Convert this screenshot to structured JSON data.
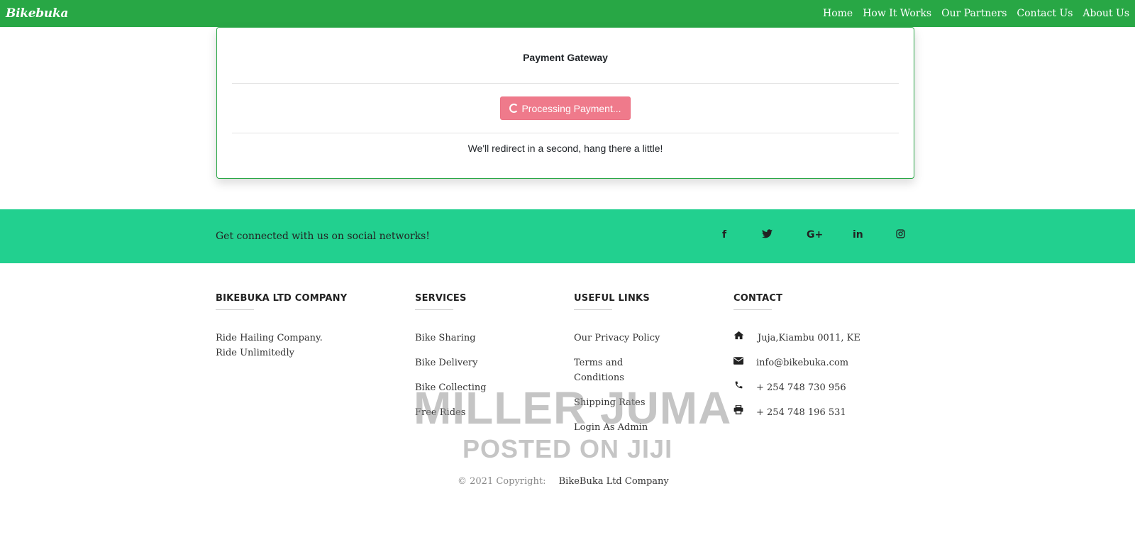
{
  "navbar": {
    "brand": "Bikebuka",
    "links": [
      "Home",
      "How It Works",
      "Our Partners",
      "Contact Us",
      "About Us"
    ]
  },
  "card": {
    "title": "Payment Gateway",
    "button_label": "Processing Payment...",
    "message": "We'll redirect in a second, hang there a little!"
  },
  "social": {
    "text": "Get connected with us on social networks!",
    "icons": [
      "f",
      "🐦",
      "G+",
      "in",
      "◎"
    ]
  },
  "footer": {
    "company": {
      "heading": "BIKEBUKA LTD COMPANY",
      "line1": "Ride Hailing Company.",
      "line2": "Ride Unlimitedly"
    },
    "services": {
      "heading": "SERVICES",
      "items": [
        "Bike Sharing",
        "Bike Delivery",
        "Bike Collecting",
        "Free Rides"
      ]
    },
    "useful_links": {
      "heading": "USEFUL LINKS",
      "items": [
        "Our Privacy Policy",
        "Terms and Conditions",
        "Shipping Rates",
        "Login As Admin"
      ]
    },
    "contact": {
      "heading": "CONTACT",
      "address": "Juja,Kiambu 0011, KE",
      "email": "info@bikebuka.com",
      "phone": "+ 254 748 730 956",
      "fax": "+ 254 748 196 531"
    },
    "copyright_prefix": "© 2021 Copyright:",
    "copyright_link": "BikeBuka Ltd Company"
  },
  "watermark": {
    "line1": "MILLER JUMA",
    "line2": "POSTED ON JIJI"
  },
  "colors": {
    "navbar": "#28a745",
    "social_band": "#22d08f",
    "button": "#ef7a8b"
  }
}
